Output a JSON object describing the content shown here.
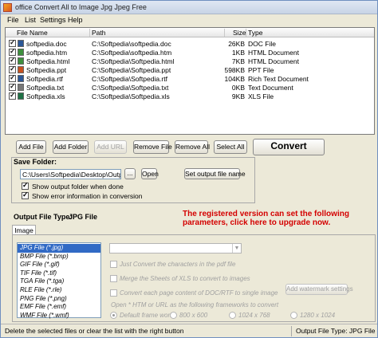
{
  "window": {
    "title": "office Convert All to Image Jpg Jpeg Free"
  },
  "menu": [
    "File",
    "List",
    "Settings",
    "Help"
  ],
  "files": {
    "columns": [
      "File Name",
      "Path",
      "Size",
      "Type"
    ],
    "rows": [
      {
        "name": "softpedia.doc",
        "path": "C:\\Softpedia\\softpedia.doc",
        "size": "26KB",
        "type": "DOC File",
        "icon": "word-doc-icon",
        "color": "#2b5797"
      },
      {
        "name": "softpedia.htm",
        "path": "C:\\Softpedia\\softpedia.htm",
        "size": "1KB",
        "type": "HTML Document",
        "icon": "html-doc-icon",
        "color": "#3d8f3d"
      },
      {
        "name": "Softpedia.html",
        "path": "C:\\Softpedia\\Softpedia.html",
        "size": "7KB",
        "type": "HTML Document",
        "icon": "html-doc-icon",
        "color": "#3d8f3d"
      },
      {
        "name": "Softpedia.ppt",
        "path": "C:\\Softpedia\\Softpedia.ppt",
        "size": "598KB",
        "type": "PPT File",
        "icon": "ppt-icon",
        "color": "#c8501e"
      },
      {
        "name": "Softpedia.rtf",
        "path": "C:\\Softpedia\\Softpedia.rtf",
        "size": "104KB",
        "type": "Rich Text Document",
        "icon": "rtf-icon",
        "color": "#2b5797"
      },
      {
        "name": "Softpedia.txt",
        "path": "C:\\Softpedia\\Softpedia.txt",
        "size": "0KB",
        "type": "Text Document",
        "icon": "txt-icon",
        "color": "#777777"
      },
      {
        "name": "Softpedia.xls",
        "path": "C:\\Softpedia\\Softpedia.xls",
        "size": "9KB",
        "type": "XLS File",
        "icon": "xls-icon",
        "color": "#1e7145"
      }
    ]
  },
  "toolbar": {
    "add_file": "Add File",
    "add_folder": "Add Folder",
    "add_url": "Add URL",
    "remove_file": "Remove File",
    "remove_all": "Remove All",
    "select_all": "Select All",
    "convert": "Convert"
  },
  "save": {
    "label": "Save Folder:",
    "path": "C:\\Users\\Softpedia\\Desktop\\Output Files",
    "browse": "...",
    "open": "Open",
    "set_name": "Set output file name",
    "show_output": "Show output folder when done",
    "show_error": "Show error information in conversion"
  },
  "output_type": {
    "label": "Output File Type:",
    "value": "JPG File"
  },
  "registered_notice": {
    "line1": "The registered version can set the following",
    "line2": "parameters, click here to upgrade now."
  },
  "tab": {
    "label": "Image"
  },
  "formats": [
    "JPG File  (*.jpg)",
    "BMP File  (*.bmp)",
    "GIF File  (*.gif)",
    "TIF File  (*.tif)",
    "TGA File  (*.tga)",
    "RLE File  (*.rle)",
    "PNG File  (*.png)",
    "EMF File  (*.emf)",
    "WMF File  (*.wmf)"
  ],
  "options": {
    "just_convert": "Just Convert the characters in the pdf file",
    "merge_sheets": "Merge the Sheets of XLS to convert to images",
    "convert_each": "Convert each page content of DOC/RTF to single image",
    "add_watermark": "Add watermark settings",
    "open_note": "Open * HTM or URL as the following frameworks to convert",
    "frames": [
      "Default frame work",
      "800 x 600",
      "1024 x 768",
      "1280 x 1024"
    ]
  },
  "status": {
    "left": "Delete the selected files or clear the list with the right button",
    "right": "Output File Type:  JPG File"
  }
}
